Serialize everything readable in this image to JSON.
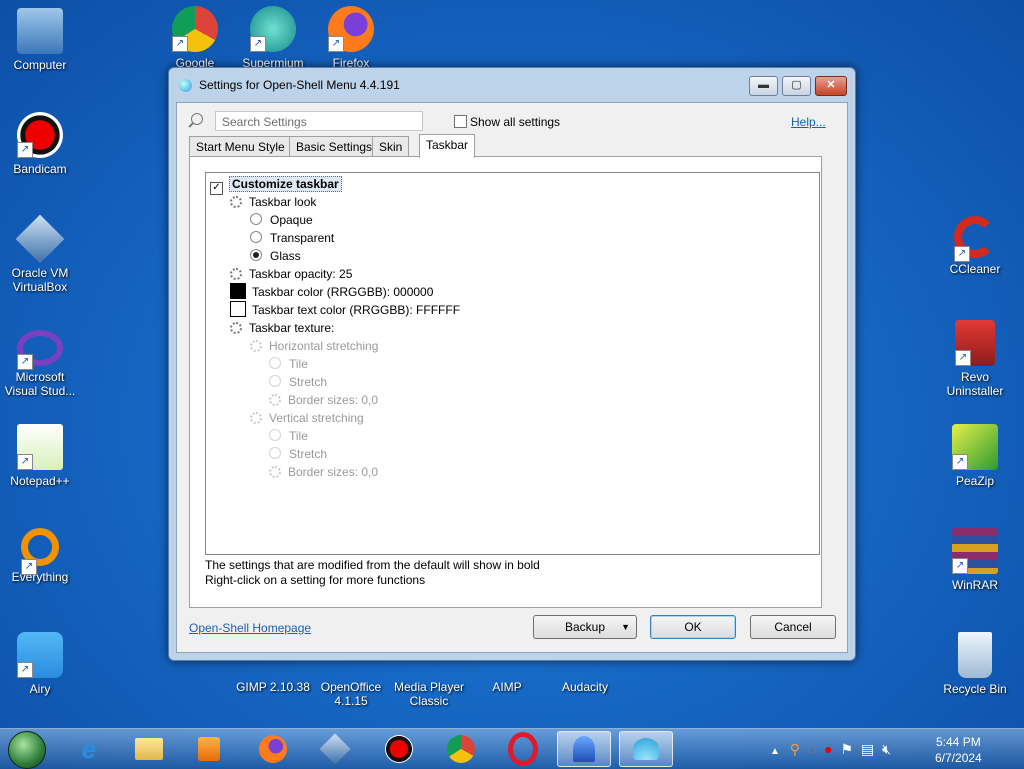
{
  "desktop": {
    "icons_left": [
      "Computer",
      "Bandicam",
      "Oracle VM VirtualBox",
      "Microsoft Visual Stud...",
      "Notepad++",
      "Everything",
      "Airy"
    ],
    "icons_top": [
      "Google",
      "Supermium",
      "Firefox"
    ],
    "icons_right": [
      "CCleaner",
      "Revo Uninstaller",
      "PeaZip",
      "WinRAR",
      "Recycle Bin"
    ],
    "icons_bottom": [
      "GIMP 2.10.38",
      "OpenOffice 4.1.15",
      "Media Player Classic",
      "AIMP",
      "Audacity"
    ]
  },
  "window": {
    "title": "Settings for Open-Shell Menu 4.4.191",
    "min_glyph": "▬",
    "max_glyph": "▢",
    "close_glyph": "✕",
    "search_placeholder": "Search Settings",
    "show_all": "Show all settings",
    "help": "Help...",
    "tabs": [
      "Start Menu Style",
      "Basic Settings",
      "Skin",
      "Taskbar"
    ],
    "active_tab": "Taskbar",
    "tree": [
      {
        "label": "Customize taskbar",
        "level": 0,
        "type": "checkbox",
        "checked": true,
        "bold": true,
        "disabled": false
      },
      {
        "label": "Taskbar look",
        "level": 1,
        "type": "gear",
        "disabled": false
      },
      {
        "label": "Opaque",
        "level": 2,
        "type": "radio",
        "checked": false,
        "disabled": false
      },
      {
        "label": "Transparent",
        "level": 2,
        "type": "radio",
        "checked": false,
        "disabled": false
      },
      {
        "label": "Glass",
        "level": 2,
        "type": "radio",
        "checked": true,
        "disabled": false
      },
      {
        "label": "Taskbar opacity: 25",
        "level": 1,
        "type": "gear",
        "disabled": false
      },
      {
        "label": "Taskbar color (RRGGBB): 000000",
        "level": 1,
        "type": "swatch",
        "color": "#000000",
        "disabled": false
      },
      {
        "label": "Taskbar text color (RRGGBB): FFFFFF",
        "level": 1,
        "type": "swatch",
        "color": "#FFFFFF",
        "disabled": false
      },
      {
        "label": "Taskbar texture:",
        "level": 1,
        "type": "gear",
        "disabled": false
      },
      {
        "label": "Horizontal stretching",
        "level": 2,
        "type": "gear",
        "disabled": true
      },
      {
        "label": "Tile",
        "level": 3,
        "type": "radio",
        "checked": false,
        "disabled": true
      },
      {
        "label": "Stretch",
        "level": 3,
        "type": "radio",
        "checked": false,
        "disabled": true
      },
      {
        "label": "Border sizes: 0,0",
        "level": 3,
        "type": "gear",
        "disabled": true
      },
      {
        "label": "Vertical stretching",
        "level": 2,
        "type": "gear",
        "disabled": true
      },
      {
        "label": "Tile",
        "level": 3,
        "type": "radio",
        "checked": false,
        "disabled": true
      },
      {
        "label": "Stretch",
        "level": 3,
        "type": "radio",
        "checked": false,
        "disabled": true
      },
      {
        "label": "Border sizes: 0,0",
        "level": 3,
        "type": "gear",
        "disabled": true
      }
    ],
    "info_line1": "The settings that are modified from the default will show in bold",
    "info_line2": "Right-click on a setting for more functions",
    "homepage": "Open-Shell Homepage",
    "backup": "Backup",
    "ok": "OK",
    "cancel": "Cancel"
  },
  "taskbar": {
    "apps": [
      "internet-explorer",
      "file-explorer",
      "media-player",
      "firefox",
      "virtualbox",
      "bandicam",
      "chrome",
      "opera",
      "open-shell",
      "airy"
    ],
    "time": "5:44 PM",
    "date": "6/7/2024"
  },
  "colors": {
    "accent": "#1a5fb4",
    "desktop": "#1668c4"
  }
}
